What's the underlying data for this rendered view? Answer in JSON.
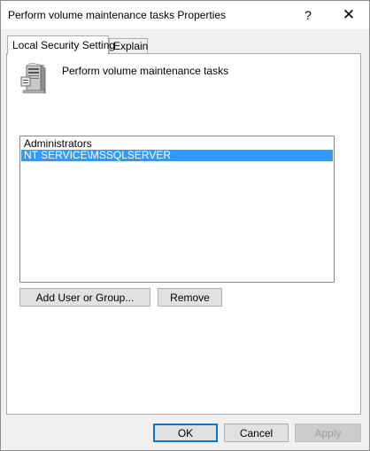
{
  "window": {
    "title": "Perform volume maintenance tasks Properties",
    "help_glyph": "?",
    "close_glyph": "✕"
  },
  "tabs": [
    {
      "label": "Local Security Setting",
      "active": true
    },
    {
      "label": "Explain",
      "active": false
    }
  ],
  "policy": {
    "icon": "server-icon",
    "name": "Perform volume maintenance tasks"
  },
  "members": [
    {
      "name": "Administrators",
      "selected": false
    },
    {
      "name": "NT SERVICE\\MSSQLSERVER",
      "selected": true
    }
  ],
  "buttons": {
    "add": "Add User or Group...",
    "remove": "Remove",
    "ok": "OK",
    "cancel": "Cancel",
    "apply": "Apply"
  },
  "colors": {
    "selection": "#3399ff",
    "default_button_border": "#0078d7"
  }
}
